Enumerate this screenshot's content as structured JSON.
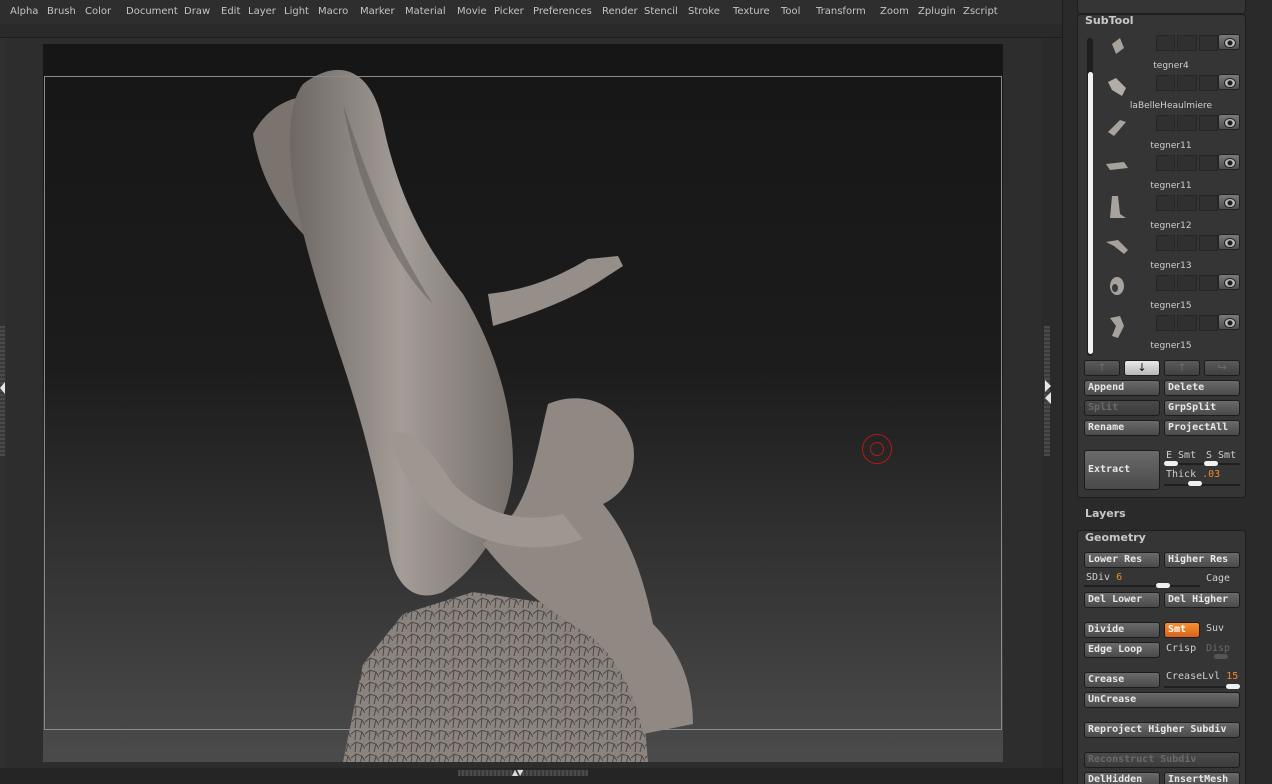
{
  "menu": [
    "Alpha",
    "Brush",
    "Color",
    "Document",
    "Draw",
    "Edit",
    "Layer",
    "Light",
    "Macro",
    "Marker",
    "Material",
    "Movie",
    "Picker",
    "Preferences",
    "Render",
    "Stencil",
    "Stroke",
    "Texture",
    "Tool",
    "Transform",
    "Zoom",
    "Zplugin",
    "Zscript"
  ],
  "subtool": {
    "title": "SubTool",
    "items": [
      {
        "name": "tegner4",
        "icon": "tegner4-thumbnail-icon"
      },
      {
        "name": "laBelleHeaulmiere",
        "icon": "hand-thumbnail-icon"
      },
      {
        "name": "tegner11",
        "icon": "arm-thumbnail-icon"
      },
      {
        "name": "tegner11",
        "icon": "arm-thumbnail-icon"
      },
      {
        "name": "tegner12",
        "icon": "figure-thumbnail-icon"
      },
      {
        "name": "tegner13",
        "icon": "arm-thumbnail-icon"
      },
      {
        "name": "tegner15",
        "icon": "head-thumbnail-icon"
      },
      {
        "name": "tegner15",
        "icon": "figure-thumbnail-icon"
      }
    ],
    "nav": [
      "↑",
      "↓",
      "↑",
      "↪"
    ],
    "append": "Append",
    "delete": "Delete",
    "split": "Split",
    "grpsplit": "GrpSplit",
    "rename": "Rename",
    "projectall": "ProjectAll",
    "extract": "Extract",
    "e_smt": "E Smt",
    "s_smt": "S Smt",
    "thick_label": "Thick",
    "thick_value": ".03"
  },
  "layers": {
    "title": "Layers"
  },
  "geometry": {
    "title": "Geometry",
    "lower_res": "Lower Res",
    "higher_res": "Higher Res",
    "sdiv_label": "SDiv",
    "sdiv_value": "6",
    "cage": "Cage",
    "del_lower": "Del Lower",
    "del_higher": "Del Higher",
    "divide": "Divide",
    "smt": "Smt",
    "suv": "Suv",
    "edge_loop": "Edge Loop",
    "crisp": "Crisp",
    "disp": "Disp",
    "crease": "Crease",
    "crease_lvl_label": "CreaseLvl",
    "crease_lvl_value": "15",
    "uncrease": "UnCrease",
    "reproject": "Reproject Higher Subdiv",
    "reconstruct": "Reconstruct Subdiv",
    "del_hidden": "DelHidden",
    "insert_mesh": "InsertMesh"
  },
  "colors": {
    "accent": "#e8772a",
    "cursor": "#b21a1a",
    "sculpt": "#8e8782"
  }
}
